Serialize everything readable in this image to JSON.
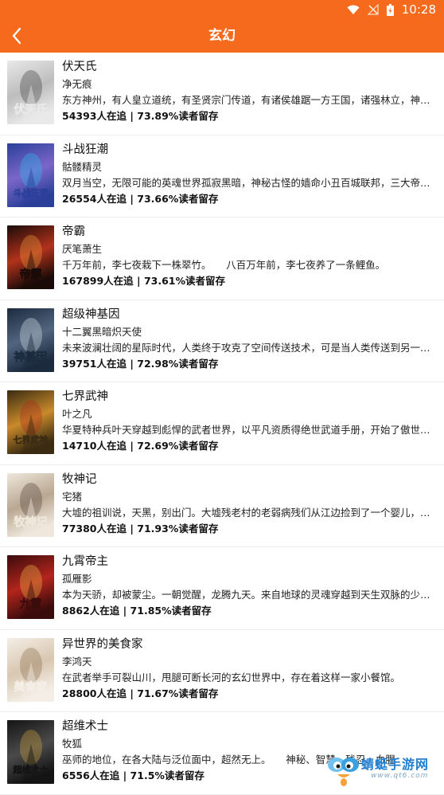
{
  "status_bar": {
    "time": "10:28"
  },
  "header": {
    "title": "玄幻"
  },
  "books": [
    {
      "title": "伏天氏",
      "author": "净无痕",
      "description": "东方神州，有人皇立道统，有圣贤宗门传道，有诸侯雄踞一方王国，诸强林立，神州动乱千万载",
      "stats": "54393人在追 | 73.89%读者留存",
      "cover_text": "伏天氏",
      "cover_colors": [
        "#e9e9e9",
        "#bdbdbd",
        "#3a3a3a"
      ]
    },
    {
      "title": "斗战狂潮",
      "author": "骷髅精灵",
      "description": "双月当空，无限可能的英魂世界孤寂黑暗，神秘古怪的嫱命小丑百城联邦，三大帝国，异族横行",
      "stats": "26554人在追 | 73.66%读者留存",
      "cover_text": "斗战狂潮",
      "cover_colors": [
        "#2a3f9a",
        "#7b66c9",
        "#2bc0f0"
      ]
    },
    {
      "title": "帝霸",
      "author": "厌笔萧生",
      "description": "千万年前，李七夜栽下一株翠竹。　　八百万年前，李七夜养了一条鲤鱼。",
      "stats": "167899人在追 | 73.61%读者留存",
      "cover_text": "帝霸",
      "cover_colors": [
        "#1a0b08",
        "#b2321c",
        "#f0a040"
      ]
    },
    {
      "title": "超级神基因",
      "author": "十二翼黑暗炽天使",
      "description": "未来波澜壮阔的星际时代，人类终于攻克了空间传送技术，可是当人类传送到另一个空间",
      "stats": "39751人在追 | 72.98%读者留存",
      "cover_text": "神基因",
      "cover_colors": [
        "#1c2a3e",
        "#51657e",
        "#dfe7ef"
      ]
    },
    {
      "title": "七界武神",
      "author": "叶之凡",
      "description": "华夏特种兵叶天穿越到彪悍的武者世界，以平凡资质得绝世武道手册，开始了傲世之路",
      "stats": "14710人在追 | 72.69%读者留存",
      "cover_text": "七界武神",
      "cover_colors": [
        "#3a2b12",
        "#c98a2a",
        "#b1271d"
      ]
    },
    {
      "title": "牧神记",
      "author": "宅猪",
      "description": "大墟的祖训说，天黑，别出门。大墟残老村的老弱病残们从江边捡到了一个婴儿，取名秦牧",
      "stats": "77380人在追 | 71.93%读者留存",
      "cover_text": "牧神记",
      "cover_colors": [
        "#efe7dc",
        "#b9a791",
        "#4d4037"
      ]
    },
    {
      "title": "九霄帝主",
      "author": "孤雁影",
      "description": "本为天骄，却被蒙尘。一朝觉醒，龙腾九天。来自地球的灵魂穿越到天生双脉的少年身上",
      "stats": "8862人在追 | 71.85%读者留存",
      "cover_text": "九霄",
      "cover_colors": [
        "#3a0c0c",
        "#b3241c",
        "#f2c04a"
      ]
    },
    {
      "title": "异世界的美食家",
      "author": "李鸿天",
      "description": "在武者举手可裂山川，甩腿可断长河的玄幻世界中，存在着这样一家小餐馆。",
      "stats": "28800人在追 | 71.67%读者留存",
      "cover_text": "美食家",
      "cover_colors": [
        "#f4eee6",
        "#d8c7b1",
        "#8a6a4a"
      ]
    },
    {
      "title": "超维术士",
      "author": "牧狐",
      "description": "巫师的地位，在各大陆与泛位面中，超然无上。　　神秘、智慧、残忍、血腥",
      "stats": "6556人在追 | 71.5%读者留存",
      "cover_text": "超维术士",
      "cover_colors": [
        "#141414",
        "#4a4a4a",
        "#d8a640"
      ]
    }
  ],
  "watermark": {
    "line1": "蜻蜓手游网",
    "line2": "www.qt6.com"
  }
}
